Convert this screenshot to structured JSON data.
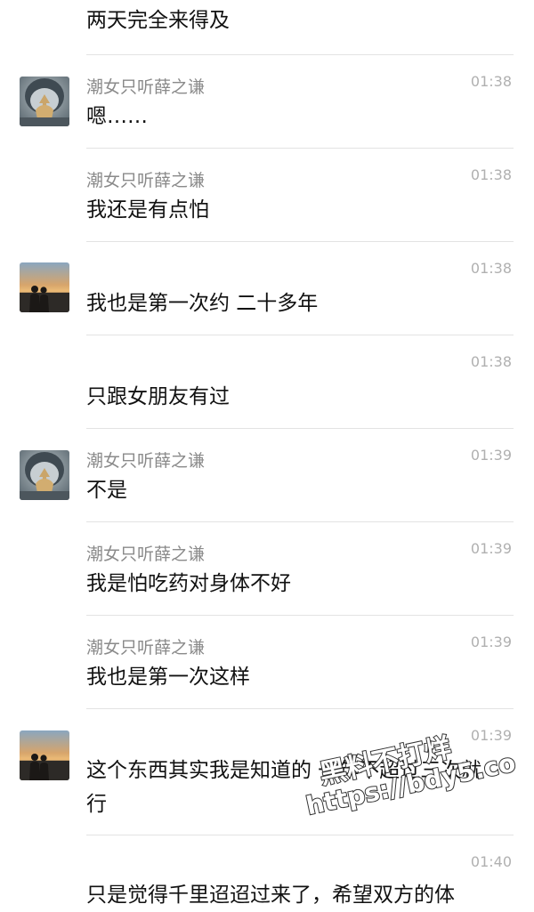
{
  "messages": [
    {
      "id": "m0",
      "sender": "",
      "time": "",
      "text": "两天完全来得及",
      "avatar": "none"
    },
    {
      "id": "m1",
      "sender": "潮女只听薛之谦",
      "time": "01:38",
      "text": "嗯……",
      "avatar": "hood"
    },
    {
      "id": "m2",
      "sender": "潮女只听薛之谦",
      "time": "01:38",
      "text": "我还是有点怕",
      "avatar": "none"
    },
    {
      "id": "m3",
      "sender": "",
      "time": "01:38",
      "text": "我也是第一次约 二十多年",
      "avatar": "sunset"
    },
    {
      "id": "m4",
      "sender": "",
      "time": "01:38",
      "text": "只跟女朋友有过",
      "avatar": "none"
    },
    {
      "id": "m5",
      "sender": "潮女只听薛之谦",
      "time": "01:39",
      "text": "不是",
      "avatar": "hood"
    },
    {
      "id": "m6",
      "sender": "潮女只听薛之谦",
      "time": "01:39",
      "text": "我是怕吃药对身体不好",
      "avatar": "none"
    },
    {
      "id": "m7",
      "sender": "潮女只听薛之谦",
      "time": "01:39",
      "text": "我也是第一次这样",
      "avatar": "none"
    },
    {
      "id": "m8",
      "sender": "",
      "time": "01:39",
      "text": "这个东西其实我是知道的 一年不超过三次就行",
      "avatar": "sunset"
    },
    {
      "id": "m9",
      "sender": "",
      "time": "01:40",
      "text": "只是觉得千里迢迢过来了，希望双方的体",
      "avatar": "none"
    }
  ],
  "watermark": {
    "line1": "黑料不打烊",
    "line2": "https://bdy5.co"
  },
  "colors": {
    "background": "#ffffff",
    "name": "#8a8a8a",
    "time": "#b0b0b0",
    "divider": "#e3e3e3"
  }
}
